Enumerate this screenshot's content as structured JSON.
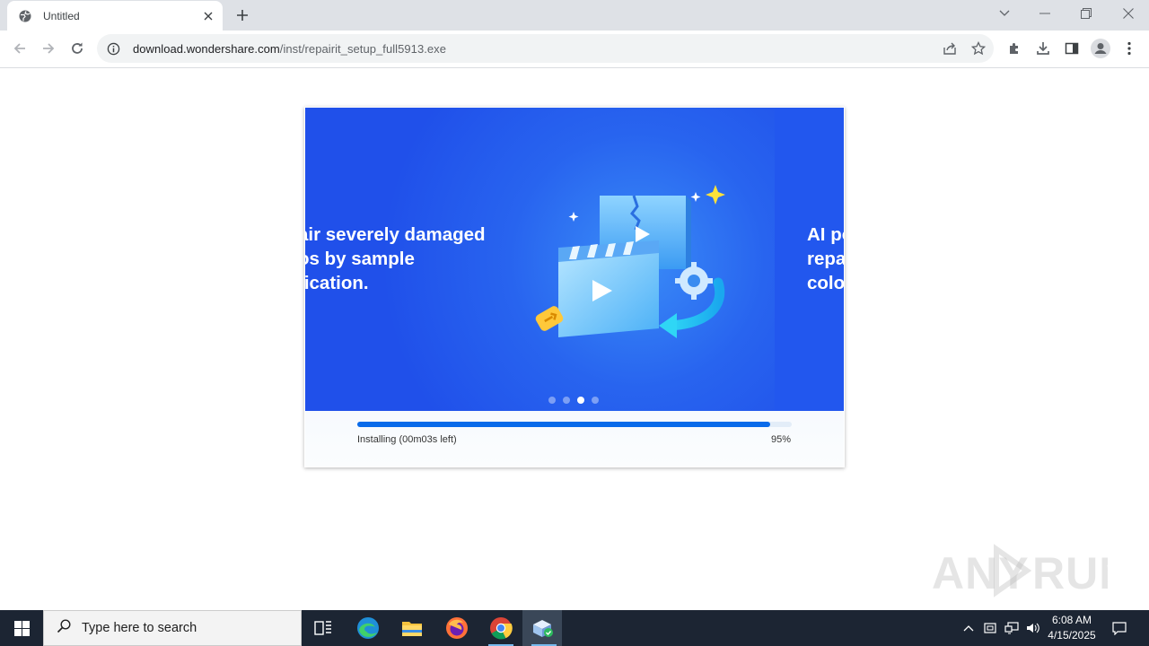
{
  "browser": {
    "tab_title": "Untitled",
    "url_host": "download.wondershare.com",
    "url_path": "/inst/repairit_setup_full5913.exe",
    "icons": [
      "globe-icon",
      "close-icon",
      "plus-icon",
      "chevron-down-icon",
      "minimize-icon",
      "restore-icon",
      "window-close-icon",
      "back-icon",
      "forward-icon",
      "reload-icon",
      "info-icon",
      "share-icon",
      "star-icon",
      "extensions-icon",
      "download-icon",
      "side-panel-icon",
      "profile-icon",
      "menu-icon"
    ]
  },
  "installer": {
    "slide_left_lines": [
      "air severely damaged",
      "os by sample",
      "fication."
    ],
    "slide_right_lines": [
      "AI po",
      "repa",
      "colo"
    ],
    "carousel_total": 4,
    "carousel_active": 2,
    "progress_percent": 95,
    "status_text": "Installing (00m03s left)",
    "percent_label": "95%",
    "accent": "#0a6bea",
    "banner_color": "#2864ef"
  },
  "watermark": "ANY RUN",
  "taskbar": {
    "search_placeholder": "Type here to search",
    "time": "6:08 AM",
    "date": "4/15/2025",
    "apps": [
      "task-view-icon",
      "edge-icon",
      "file-explorer-icon",
      "firefox-icon",
      "chrome-icon",
      "installer-icon"
    ],
    "tray": [
      "chevron-up-icon",
      "tablet-icon",
      "network-icon",
      "volume-icon",
      "notification-icon"
    ]
  }
}
